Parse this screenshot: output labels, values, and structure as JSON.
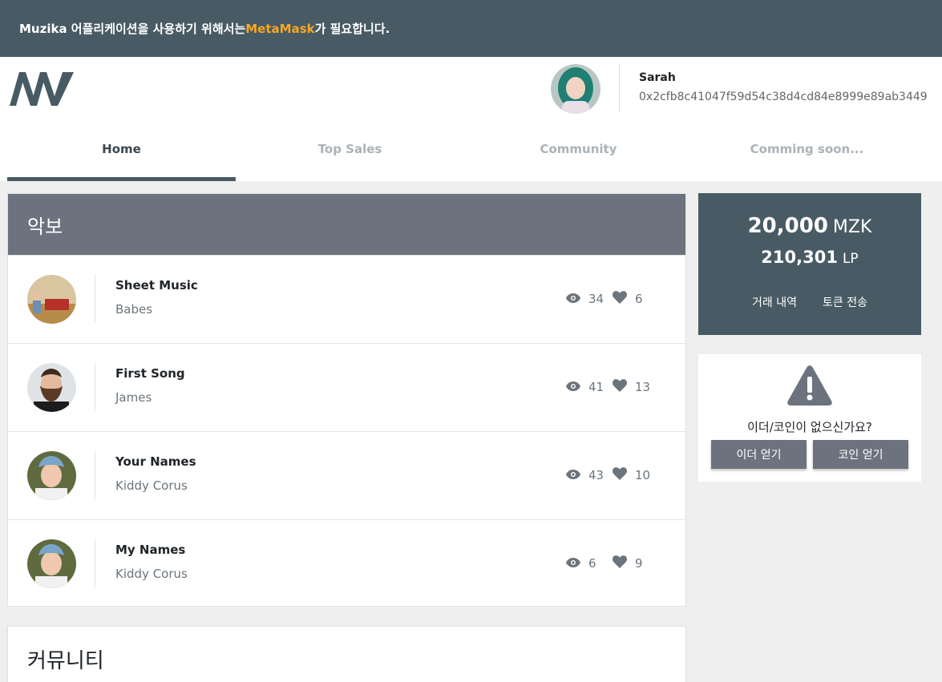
{
  "banner": {
    "before": "Muzika 어플리케이션을 사용하기 위해서는 ",
    "highlight": "MetaMask",
    "after": "가 필요합니다.",
    "highlight_color": "#f6a623"
  },
  "user": {
    "name": "Sarah",
    "address": "0x2cfb8c41047f59d54c38d4cd84e8999e89ab3449"
  },
  "tabs": [
    {
      "label": "Home",
      "active": true
    },
    {
      "label": "Top Sales",
      "active": false
    },
    {
      "label": "Community",
      "active": false
    },
    {
      "label": "Comming soon...",
      "active": false
    }
  ],
  "sheets": {
    "title": "악보",
    "items": [
      {
        "title": "Sheet Music",
        "artist": "Babes",
        "views": "34",
        "likes": "6"
      },
      {
        "title": "First Song",
        "artist": "James",
        "views": "41",
        "likes": "13"
      },
      {
        "title": "Your Names",
        "artist": "Kiddy Corus",
        "views": "43",
        "likes": "10"
      },
      {
        "title": "My Names",
        "artist": "Kiddy Corus",
        "views": "6",
        "likes": "9"
      }
    ]
  },
  "community": {
    "title": "커뮤니티"
  },
  "wallet": {
    "mzk_value": "20,000",
    "mzk_unit": "MZK",
    "lp_value": "210,301",
    "lp_unit": "LP",
    "history_label": "거래 내역",
    "send_label": "토큰 전송"
  },
  "warning": {
    "question": "이더/코인이 없으신가요?",
    "ether_button": "이더 얻기",
    "coin_button": "코인 얻기"
  },
  "colors": {
    "header_bg": "#485b65",
    "card_head_bg": "#6c737e",
    "button_bg": "#6c737e",
    "page_bg": "#efefef"
  }
}
